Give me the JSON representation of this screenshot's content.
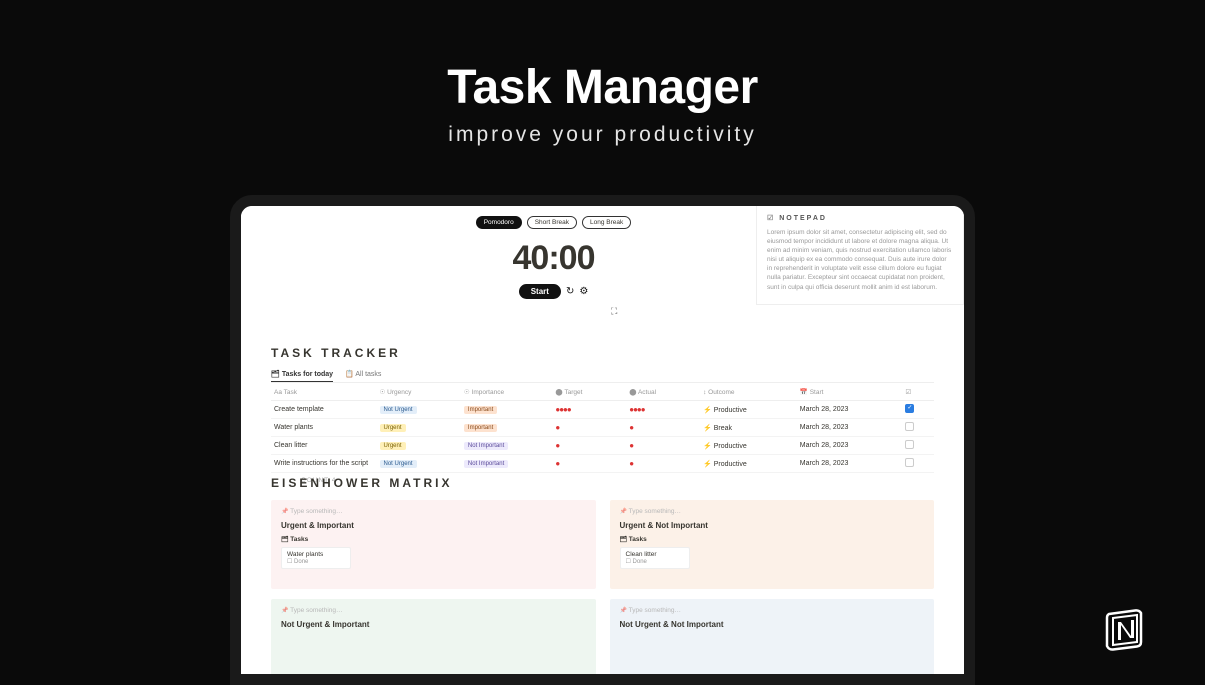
{
  "hero": {
    "title": "Task Manager",
    "subtitle": "improve your productivity"
  },
  "pomodoro": {
    "modes": [
      "Pomodoro",
      "Short Break",
      "Long Break"
    ],
    "active_mode": "Pomodoro",
    "time": "40:00",
    "start_label": "Start"
  },
  "notepad": {
    "header": "NOTEPAD",
    "body": "Lorem ipsum dolor sit amet, consectetur adipiscing elit, sed do eiusmod tempor incididunt ut labore et dolore magna aliqua. Ut enim ad minim veniam, quis nostrud exercitation ullamco laboris nisi ut aliquip ex ea commodo consequat. Duis aute irure dolor in reprehenderit in voluptate velit esse cillum dolore eu fugiat nulla pariatur. Excepteur sint occaecat cupidatat non proident, sunt in culpa qui officia deserunt mollit anim id est laborum."
  },
  "tracker": {
    "title": "TASK TRACKER",
    "tabs": {
      "active": "Tasks for today",
      "other": "All tasks"
    },
    "columns": [
      "Task",
      "Urgency",
      "Importance",
      "Target",
      "Actual",
      "Outcome",
      "Start",
      ""
    ],
    "rows": [
      {
        "task": "Create template",
        "urgency": "Not Urgent",
        "importance": "Important",
        "target": 4,
        "actual": 4,
        "outcome": "Productive",
        "start": "March 28, 2023",
        "done": true
      },
      {
        "task": "Water plants",
        "urgency": "Urgent",
        "importance": "Important",
        "target": 1,
        "actual": 1,
        "outcome": "Break",
        "start": "March 28, 2023",
        "done": false
      },
      {
        "task": "Clean litter",
        "urgency": "Urgent",
        "importance": "Not Important",
        "target": 1,
        "actual": 1,
        "outcome": "Productive",
        "start": "March 28, 2023",
        "done": false
      },
      {
        "task": "Write instructions for the script",
        "urgency": "Not Urgent",
        "importance": "Not Important",
        "target": 1,
        "actual": 1,
        "outcome": "Productive",
        "start": "March 28, 2023",
        "done": false
      }
    ],
    "count_label": "COUNT 4"
  },
  "eisenhower": {
    "title": "EISENHOWER MATRIX",
    "placeholder": "Type something…",
    "tasks_label": "Tasks",
    "done_label": "Done",
    "quads": [
      {
        "title": "Urgent & Important",
        "card": "Water plants",
        "class": "pink"
      },
      {
        "title": "Urgent & Not Important",
        "card": "Clean litter",
        "class": "peach"
      },
      {
        "title": "Not Urgent & Important",
        "card": null,
        "class": "mint"
      },
      {
        "title": "Not Urgent & Not Important",
        "card": null,
        "class": "blue"
      }
    ]
  }
}
